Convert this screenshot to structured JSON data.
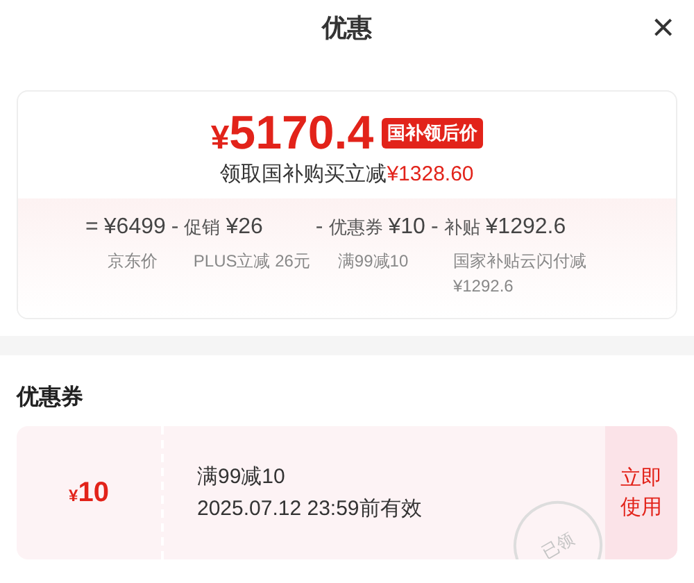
{
  "header": {
    "title": "优惠",
    "close": "×"
  },
  "price": {
    "currency": "¥",
    "value": "5170.4",
    "tag": "国补领后价",
    "saving_label": "领取国补购买立减",
    "saving_amount": "¥1328.60"
  },
  "breakdown": [
    {
      "op": "=",
      "amount": "¥6499",
      "note": "京东价"
    },
    {
      "op": "-",
      "label": "促销",
      "amount": "¥26",
      "note": "PLUS立减 26元"
    },
    {
      "op": "-",
      "label": "优惠券",
      "amount": "¥10",
      "note": "满99减10"
    },
    {
      "op": "-",
      "label": "补贴",
      "amount": "¥1292.6",
      "note": "国家补贴云闪付减¥1292.6"
    }
  ],
  "section_title": "优惠券",
  "coupons": [
    {
      "currency": "¥",
      "amount": "10",
      "condition": "满99减10",
      "validity": "2025.07.12 23:59前有效",
      "claimed": true,
      "stamp": "已领",
      "action": "立即使用"
    }
  ]
}
